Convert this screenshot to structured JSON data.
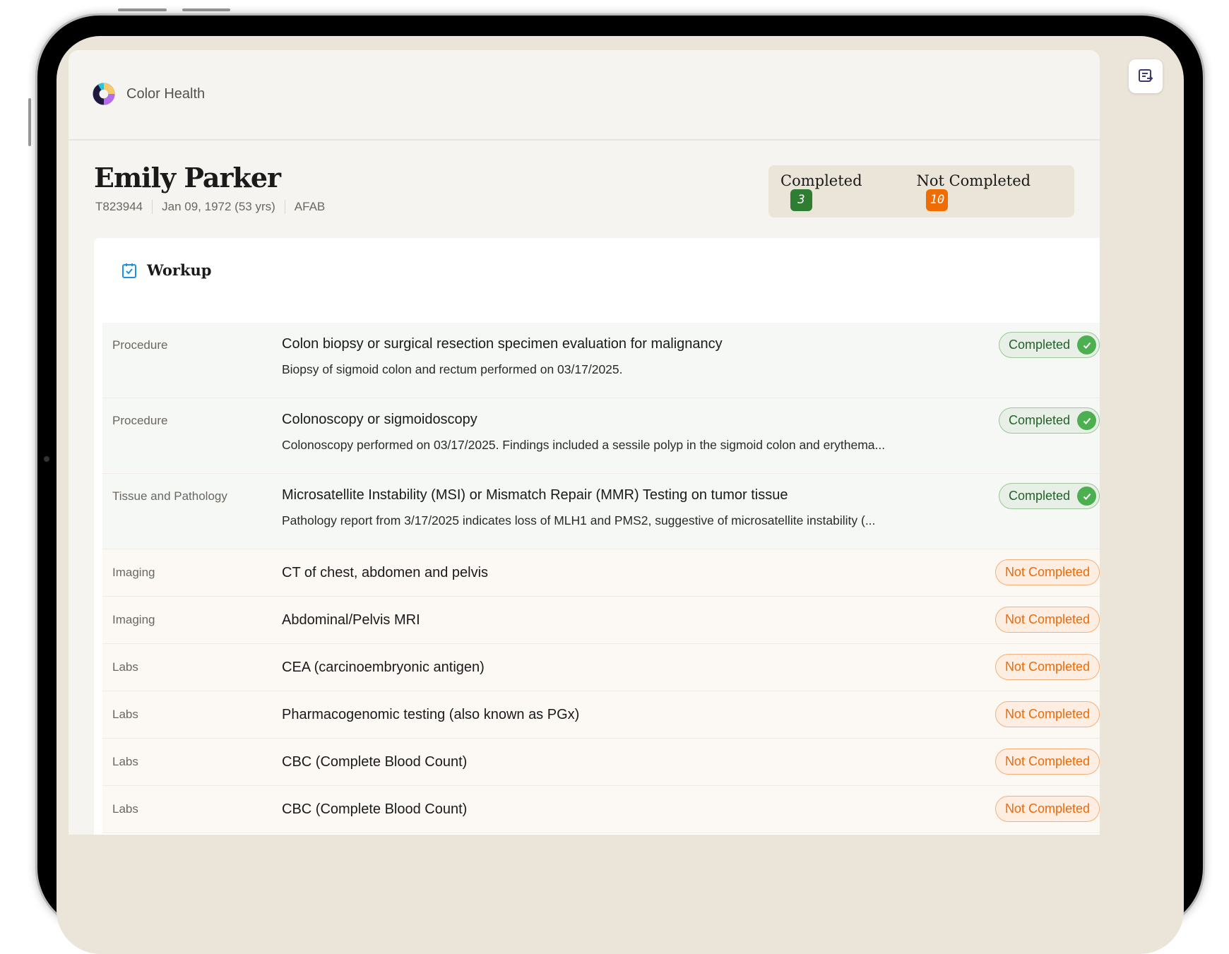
{
  "app": {
    "brand": "Color Health"
  },
  "patient": {
    "name": "Emily Parker",
    "id": "T823944",
    "dob": "Jan 09, 1972 (53 yrs)",
    "sex": "AFAB"
  },
  "summary": {
    "completed_label": "Completed",
    "completed_count": "3",
    "not_completed_label": "Not Completed",
    "not_completed_count": "10"
  },
  "colors": {
    "green": "#2e7d32",
    "orange": "#ef6c00"
  },
  "workup": {
    "title": "Workup",
    "rows": [
      {
        "category": "Procedure",
        "title": "Colon biopsy or surgical resection specimen evaluation for malignancy",
        "description": "Biopsy of sigmoid colon and rectum performed on 03/17/2025.",
        "status": "Completed"
      },
      {
        "category": "Procedure",
        "title": "Colonoscopy or sigmoidoscopy",
        "description": "Colonoscopy performed on 03/17/2025. Findings included a sessile polyp in the sigmoid colon and erythema...",
        "status": "Completed"
      },
      {
        "category": "Tissue and Pathology",
        "title": "Microsatellite Instability (MSI) or Mismatch Repair (MMR) Testing on tumor tissue",
        "description": "Pathology report from 3/17/2025 indicates loss of MLH1 and PMS2, suggestive of microsatellite instability (...",
        "status": "Completed"
      },
      {
        "category": "Imaging",
        "title": "CT of chest, abdomen and pelvis",
        "status": "Not Completed"
      },
      {
        "category": "Imaging",
        "title": "Abdominal/Pelvis MRI",
        "status": "Not Completed"
      },
      {
        "category": "Labs",
        "title": "CEA (carcinoembryonic antigen)",
        "status": "Not Completed"
      },
      {
        "category": "Labs",
        "title": "Pharmacogenomic testing (also known as PGx)",
        "status": "Not Completed"
      },
      {
        "category": "Labs",
        "title": "CBC (Complete Blood Count)",
        "status": "Not Completed"
      },
      {
        "category": "Labs",
        "title": "CBC (Complete Blood Count)",
        "status": "Not Completed"
      }
    ]
  }
}
